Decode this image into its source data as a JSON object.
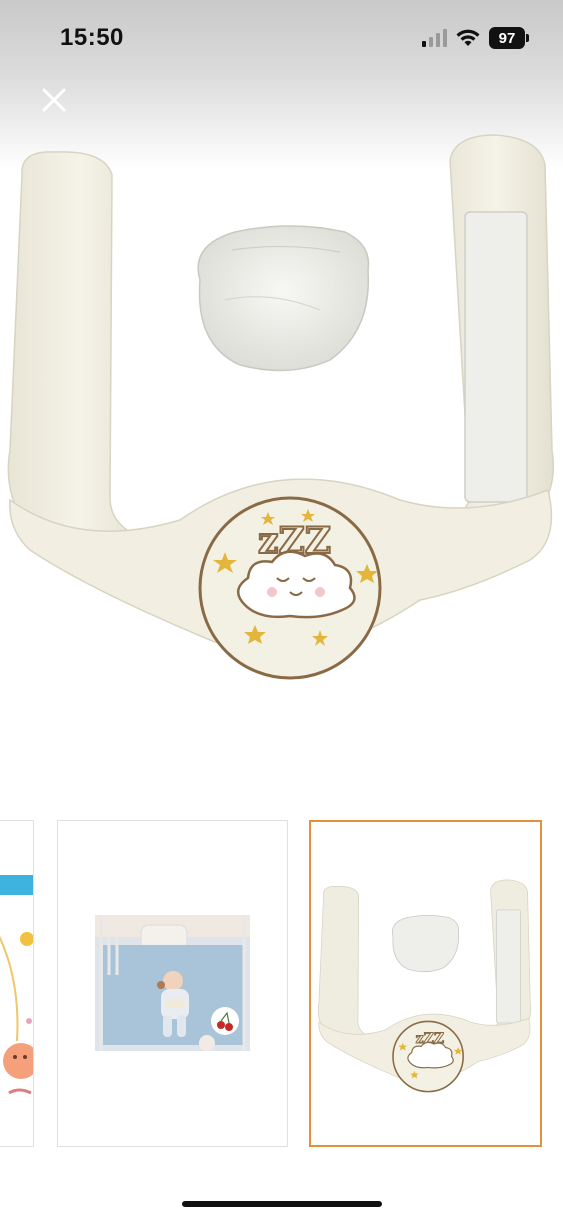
{
  "status_bar": {
    "time": "15:50",
    "battery_level": "97",
    "signal_icon": "cellular-signal-icon",
    "wifi_icon": "wifi-icon"
  },
  "header": {
    "close_icon": "close-icon"
  },
  "gallery": {
    "main_image": "baby-colic-belt-cloud-pillow-image",
    "thumbnails": [
      {
        "name": "cartoon-baby-illustration",
        "selected": false
      },
      {
        "name": "baby-in-crib-photo",
        "selected": false
      },
      {
        "name": "colic-belt-product-photo",
        "selected": true
      }
    ]
  },
  "colors": {
    "selected_border": "#e0913a",
    "product_cream": "#f2efe2",
    "embroidery_brown": "#8a6a45",
    "star_yellow": "#e3b53a"
  }
}
